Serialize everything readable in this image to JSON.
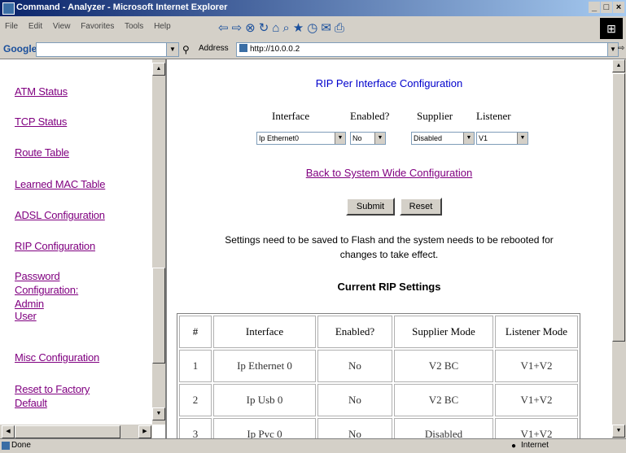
{
  "window": {
    "title": "Command - Analyzer - Microsoft Internet Explorer",
    "controls": [
      "_",
      "□",
      "×"
    ]
  },
  "menu": [
    "File",
    "Edit",
    "View",
    "Favorites",
    "Tools",
    "Help"
  ],
  "google": {
    "label": "Google -"
  },
  "address": {
    "label": "Address",
    "value": "http://10.0.0.2"
  },
  "left_nav": {
    "items": [
      "ATM Status",
      "TCP Status",
      "Route Table",
      "Learned MAC Table",
      "ADSL Configuration",
      "RIP Configuration",
      "Password",
      "Configuration:",
      "Admin",
      "User",
      "Misc Configuration",
      "Reset to Factory",
      "Default"
    ]
  },
  "main": {
    "title": "RIP Per Interface Configuration",
    "columns": [
      "Interface",
      "Enabled?",
      "Supplier",
      "Listener"
    ],
    "selects": {
      "interface": "Ip Ethernet0",
      "enabled": "No",
      "supplier": "Disabled",
      "listener": "V1"
    },
    "back_link": "Back to System Wide Configuration",
    "submit_label": "Submit",
    "reset_label": "Reset",
    "note_line1": "Settings need to be saved to Flash and the system needs to be rebooted for",
    "note_line2": "changes to take effect.",
    "current_heading": "Current RIP Settings",
    "table": {
      "headers": [
        "#",
        "Interface",
        "Enabled?",
        "Supplier Mode",
        "Listener Mode"
      ],
      "rows": [
        [
          "1",
          "Ip Ethernet 0",
          "No",
          "V2 BC",
          "V1+V2"
        ],
        [
          "2",
          "Ip Usb 0",
          "No",
          "V2 BC",
          "V1+V2"
        ],
        [
          "3",
          "Ip Pvc 0",
          "No",
          "Disabled",
          "V1+V2"
        ]
      ]
    }
  },
  "status": {
    "left": "Done",
    "zone": "Internet"
  }
}
